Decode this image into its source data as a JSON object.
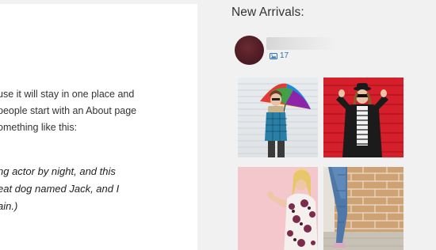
{
  "content": {
    "paragraph_lines": [
      "use it will stay in one place and",
      "people start with an About page",
      "omething like this:"
    ],
    "quote_lines": [
      "ng actor by night, and this",
      "eat dog named Jack, and I",
      "ain.)"
    ]
  },
  "sidebar": {
    "widget_title": "New Arrivals:",
    "profile": {
      "media_count": "17",
      "media_icon": "image-icon",
      "avatar_color": "#5a1f27"
    },
    "photos": [
      {
        "name": "woman-rainbow-umbrella",
        "background": "#e6e9ec"
      },
      {
        "name": "woman-red-wall-leather-jacket",
        "background": "#d51f2b"
      },
      {
        "name": "woman-pink-floral-dress",
        "background": "#f3c7cc"
      },
      {
        "name": "person-jeans-brick-wall",
        "background": "#c9996b"
      }
    ]
  }
}
